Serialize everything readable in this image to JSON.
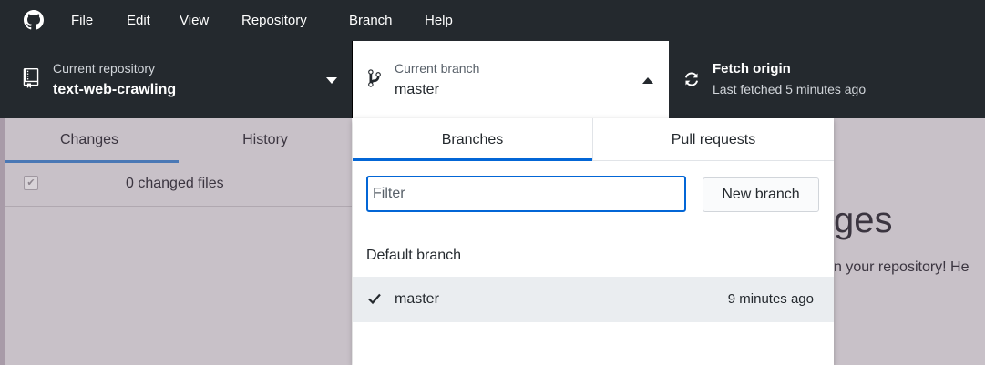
{
  "menu": {
    "items": [
      "File",
      "Edit",
      "View",
      "Repository",
      "Branch",
      "Help"
    ]
  },
  "toolbar": {
    "repository": {
      "label": "Current repository",
      "value": "text-web-crawling"
    },
    "branch": {
      "label": "Current branch",
      "value": "master"
    },
    "fetch": {
      "label": "Fetch origin",
      "status": "Last fetched 5 minutes ago"
    }
  },
  "sidebar": {
    "tabs": [
      "Changes",
      "History"
    ],
    "changed_files": "0 changed files"
  },
  "main": {
    "heading_fragment": "ges",
    "subtext_fragment": "n your repository! He"
  },
  "branch_popup": {
    "tabs": [
      "Branches",
      "Pull requests"
    ],
    "filter": {
      "placeholder": "Filter",
      "value": ""
    },
    "new_branch_label": "New branch",
    "group_header": "Default branch",
    "branches": [
      {
        "name": "master",
        "time": "9 minutes ago",
        "selected": true
      }
    ]
  },
  "colors": {
    "titlebar": "#24292e",
    "accent": "#0366d6",
    "dim_overlay": "#c8c1c8"
  }
}
